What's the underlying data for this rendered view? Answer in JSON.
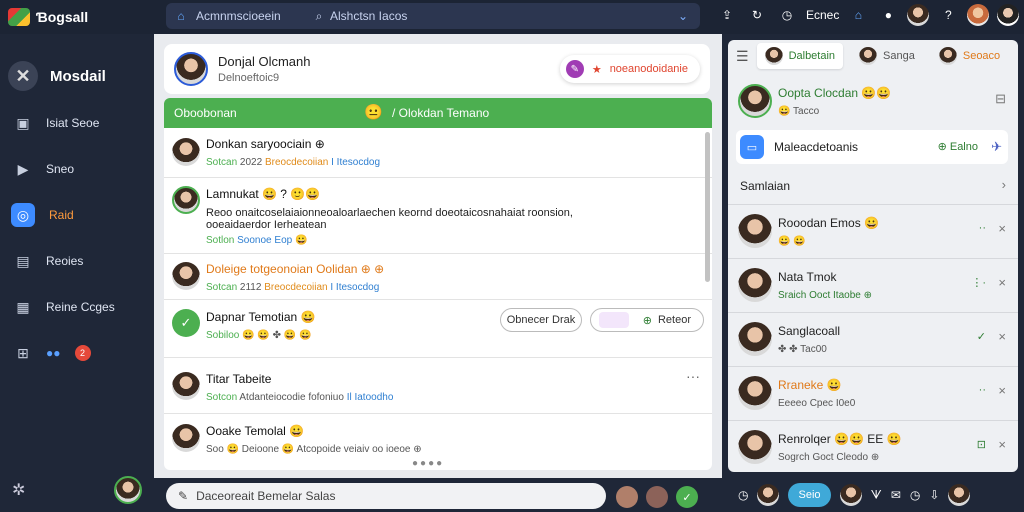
{
  "app": {
    "title": "Ɓogsall"
  },
  "topbar": {
    "crumb": "Acmnmscioeein",
    "search": "Alshctsn Iacos",
    "status": "Ecnec"
  },
  "sidebar": {
    "header": "Mosdail",
    "items": [
      {
        "label": "Isiat Seoe",
        "icon": "inbox-icon"
      },
      {
        "label": "Sneo",
        "icon": "send-icon"
      },
      {
        "label": "Raid",
        "icon": "app-icon",
        "active": true
      },
      {
        "label": "Reoies",
        "icon": "contacts-icon"
      },
      {
        "label": "Reine Ccges",
        "icon": "calendar-icon"
      },
      {
        "label": "",
        "icon": "chat-icon",
        "badge": "2"
      }
    ]
  },
  "profile": {
    "name": "Donjal Olcmanh",
    "sub": "Delnoeftoic9",
    "pill": "noeanodoidanie"
  },
  "list": {
    "header_left": "Oboobonan",
    "header_right": "/ Olokdan Temano",
    "rows": [
      {
        "title": "Donkan saryoociain ⊕",
        "meta": [
          {
            "text": "Sotcan",
            "cls": ""
          },
          {
            "text": "2022",
            "cls": "grey"
          },
          {
            "text": "Breocdecoiian",
            "cls": "orange"
          },
          {
            "text": "I Itesocdog",
            "cls": "blue"
          }
        ]
      },
      {
        "title": "Lamnukat 😀 ? 🙂😀",
        "body": "Reoo onaitcoselaiaionneoaloarlaechen keornd doeotaicosnahaiat roonsion, ooeaidaerdor Ierheatean",
        "meta": [
          {
            "text": "Sotlon",
            "cls": ""
          },
          {
            "text": "Soonoe Eop 😀",
            "cls": "blue"
          }
        ]
      },
      {
        "title": "Doleige totgeonoian Oolidan ⊕ ⊕",
        "meta": [
          {
            "text": "Sotcan",
            "cls": ""
          },
          {
            "text": "2112",
            "cls": "grey"
          },
          {
            "text": "Breocdecoiian",
            "cls": "orange"
          },
          {
            "text": "I Itesocdog",
            "cls": "blue"
          }
        ]
      },
      {
        "title": "Dapnar Temotian 😀",
        "meta": [
          {
            "text": "Sobiloo",
            "cls": ""
          },
          {
            "text": "😀 😀 ✤ 😀 😀",
            "cls": "grey"
          }
        ],
        "btn1": "Obnecer Drak",
        "btn2": "Reteor"
      },
      {
        "title": "Titar Tabeite",
        "meta": [
          {
            "text": "Sotcon",
            "cls": ""
          },
          {
            "text": "Atdanteiocodie fofoniuo",
            "cls": "grey"
          },
          {
            "text": "Il Iatoodho",
            "cls": "blue"
          }
        ]
      },
      {
        "title": "Ooake Temolal 😀",
        "meta": [
          {
            "text": "Soo",
            "cls": "grey"
          },
          {
            "text": "😀 Deioone",
            "cls": "grey"
          },
          {
            "text": "😀 Atcopoide veiaiv oo ioeoe ⊕",
            "cls": "grey"
          }
        ]
      }
    ]
  },
  "composer": {
    "placeholder": "Daceoreait Bemelar Salas"
  },
  "right": {
    "tab_active": "Dalbetain",
    "tab2": "Sanga",
    "tab3": "Seoaco",
    "contacts": [
      {
        "name": "Oopta Clocdan 😀😀",
        "sub": "😀 Tacco",
        "act": "",
        "x": "⊟"
      },
      {
        "name": "Maleacdetoanis",
        "sub": "",
        "act": "⊕ Ealno",
        "x": "",
        "highlight": true
      },
      {
        "name": "Samlaian",
        "sub": "",
        "act": "",
        "x": "›",
        "plain": true
      },
      {
        "name": "Rooodan Emos 😀",
        "sub": "😀 😀",
        "act": "··",
        "x": "×"
      },
      {
        "name": "Nata Tmok",
        "sub": "Sraich Ooct Itaobe ⊕",
        "act": "⋮·",
        "x": "×"
      },
      {
        "name": "Sanglacoall",
        "sub": "✤ ✤ Tac00",
        "act": "✓",
        "x": "×"
      },
      {
        "name": "Rraneke 😀",
        "sub": "Eeeeo Cpec I0e0",
        "act": "··",
        "x": "×"
      },
      {
        "name": "Renrolqer 😀😀 ЕЕ 😀",
        "sub": "Sogrch Goct Cleodo ⊕",
        "act": "⊡",
        "x": "×"
      }
    ]
  },
  "bottom_right": {
    "pill": "Seio"
  },
  "colors": {
    "accent": "#4caf50",
    "sidebar": "#1f2738",
    "highlight": "#3d8bff"
  }
}
